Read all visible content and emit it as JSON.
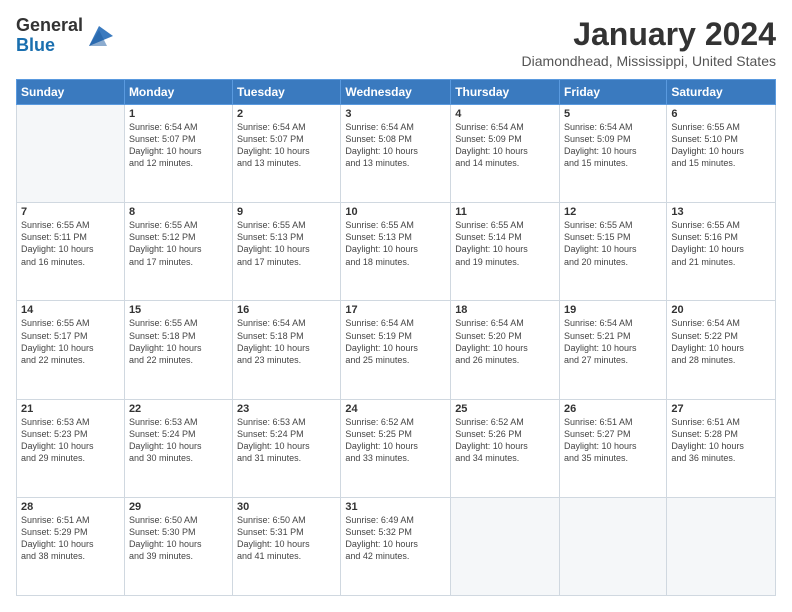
{
  "logo": {
    "general": "General",
    "blue": "Blue"
  },
  "header": {
    "title": "January 2024",
    "subtitle": "Diamondhead, Mississippi, United States"
  },
  "days_of_week": [
    "Sunday",
    "Monday",
    "Tuesday",
    "Wednesday",
    "Thursday",
    "Friday",
    "Saturday"
  ],
  "weeks": [
    [
      {
        "day": "",
        "empty": true
      },
      {
        "day": "1",
        "sunrise": "6:54 AM",
        "sunset": "5:07 PM",
        "daylight": "10 hours and 12 minutes."
      },
      {
        "day": "2",
        "sunrise": "6:54 AM",
        "sunset": "5:07 PM",
        "daylight": "10 hours and 13 minutes."
      },
      {
        "day": "3",
        "sunrise": "6:54 AM",
        "sunset": "5:08 PM",
        "daylight": "10 hours and 13 minutes."
      },
      {
        "day": "4",
        "sunrise": "6:54 AM",
        "sunset": "5:09 PM",
        "daylight": "10 hours and 14 minutes."
      },
      {
        "day": "5",
        "sunrise": "6:54 AM",
        "sunset": "5:09 PM",
        "daylight": "10 hours and 15 minutes."
      },
      {
        "day": "6",
        "sunrise": "6:55 AM",
        "sunset": "5:10 PM",
        "daylight": "10 hours and 15 minutes."
      }
    ],
    [
      {
        "day": "7",
        "sunrise": "6:55 AM",
        "sunset": "5:11 PM",
        "daylight": "10 hours and 16 minutes."
      },
      {
        "day": "8",
        "sunrise": "6:55 AM",
        "sunset": "5:12 PM",
        "daylight": "10 hours and 17 minutes."
      },
      {
        "day": "9",
        "sunrise": "6:55 AM",
        "sunset": "5:13 PM",
        "daylight": "10 hours and 17 minutes."
      },
      {
        "day": "10",
        "sunrise": "6:55 AM",
        "sunset": "5:13 PM",
        "daylight": "10 hours and 18 minutes."
      },
      {
        "day": "11",
        "sunrise": "6:55 AM",
        "sunset": "5:14 PM",
        "daylight": "10 hours and 19 minutes."
      },
      {
        "day": "12",
        "sunrise": "6:55 AM",
        "sunset": "5:15 PM",
        "daylight": "10 hours and 20 minutes."
      },
      {
        "day": "13",
        "sunrise": "6:55 AM",
        "sunset": "5:16 PM",
        "daylight": "10 hours and 21 minutes."
      }
    ],
    [
      {
        "day": "14",
        "sunrise": "6:55 AM",
        "sunset": "5:17 PM",
        "daylight": "10 hours and 22 minutes."
      },
      {
        "day": "15",
        "sunrise": "6:55 AM",
        "sunset": "5:18 PM",
        "daylight": "10 hours and 22 minutes."
      },
      {
        "day": "16",
        "sunrise": "6:54 AM",
        "sunset": "5:18 PM",
        "daylight": "10 hours and 23 minutes."
      },
      {
        "day": "17",
        "sunrise": "6:54 AM",
        "sunset": "5:19 PM",
        "daylight": "10 hours and 25 minutes."
      },
      {
        "day": "18",
        "sunrise": "6:54 AM",
        "sunset": "5:20 PM",
        "daylight": "10 hours and 26 minutes."
      },
      {
        "day": "19",
        "sunrise": "6:54 AM",
        "sunset": "5:21 PM",
        "daylight": "10 hours and 27 minutes."
      },
      {
        "day": "20",
        "sunrise": "6:54 AM",
        "sunset": "5:22 PM",
        "daylight": "10 hours and 28 minutes."
      }
    ],
    [
      {
        "day": "21",
        "sunrise": "6:53 AM",
        "sunset": "5:23 PM",
        "daylight": "10 hours and 29 minutes."
      },
      {
        "day": "22",
        "sunrise": "6:53 AM",
        "sunset": "5:24 PM",
        "daylight": "10 hours and 30 minutes."
      },
      {
        "day": "23",
        "sunrise": "6:53 AM",
        "sunset": "5:24 PM",
        "daylight": "10 hours and 31 minutes."
      },
      {
        "day": "24",
        "sunrise": "6:52 AM",
        "sunset": "5:25 PM",
        "daylight": "10 hours and 33 minutes."
      },
      {
        "day": "25",
        "sunrise": "6:52 AM",
        "sunset": "5:26 PM",
        "daylight": "10 hours and 34 minutes."
      },
      {
        "day": "26",
        "sunrise": "6:51 AM",
        "sunset": "5:27 PM",
        "daylight": "10 hours and 35 minutes."
      },
      {
        "day": "27",
        "sunrise": "6:51 AM",
        "sunset": "5:28 PM",
        "daylight": "10 hours and 36 minutes."
      }
    ],
    [
      {
        "day": "28",
        "sunrise": "6:51 AM",
        "sunset": "5:29 PM",
        "daylight": "10 hours and 38 minutes."
      },
      {
        "day": "29",
        "sunrise": "6:50 AM",
        "sunset": "5:30 PM",
        "daylight": "10 hours and 39 minutes."
      },
      {
        "day": "30",
        "sunrise": "6:50 AM",
        "sunset": "5:31 PM",
        "daylight": "10 hours and 41 minutes."
      },
      {
        "day": "31",
        "sunrise": "6:49 AM",
        "sunset": "5:32 PM",
        "daylight": "10 hours and 42 minutes."
      },
      {
        "day": "",
        "empty": true
      },
      {
        "day": "",
        "empty": true
      },
      {
        "day": "",
        "empty": true
      }
    ]
  ],
  "labels": {
    "sunrise_prefix": "Sunrise: ",
    "sunset_prefix": "Sunset: ",
    "daylight_prefix": "Daylight: "
  }
}
